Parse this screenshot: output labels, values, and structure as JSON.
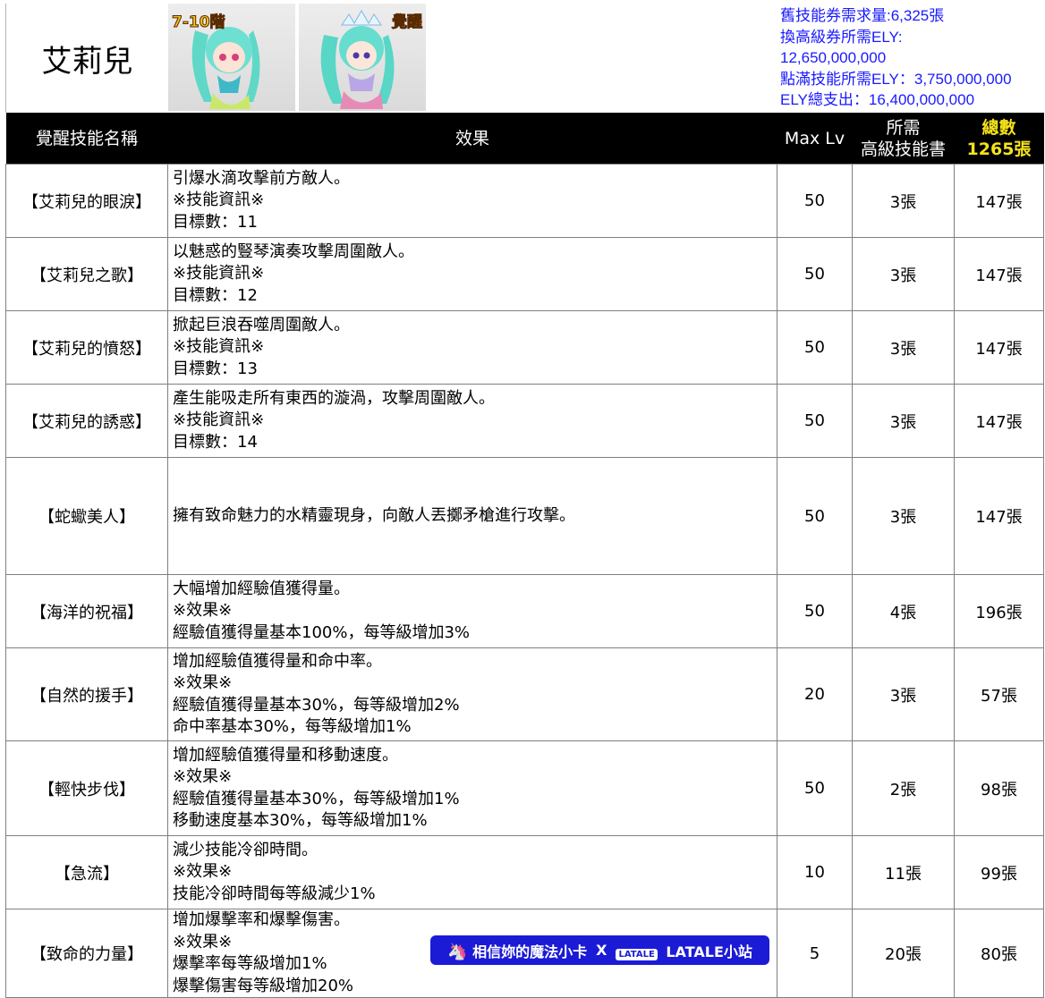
{
  "header": {
    "character_name": "艾莉兒",
    "portrait_tags": [
      "7-10階",
      "覺醒"
    ],
    "info_lines": [
      "舊技能券需求量:6,325張",
      "換高級券所需ELY:",
      "12,650,000,000",
      "點滿技能所需ELY：3,750,000,000",
      "ELY總支出：16,400,000,000"
    ]
  },
  "colors": {
    "info_text": "#1a1aff",
    "header_bg": "#000000",
    "total_highlight": "#f5e31b",
    "banner_bg": "#1b1bd6"
  },
  "table": {
    "headers": {
      "name": "覺醒技能名稱",
      "effect": "效果",
      "max_lv": "Max Lv",
      "books_line1": "所需",
      "books_line2": "高級技能書",
      "total_line1": "總數",
      "total_line2": "1265張"
    },
    "rows": [
      {
        "name": "【艾莉兒的眼淚】",
        "effect": [
          "引爆水滴攻擊前方敵人。",
          "※技能資訊※",
          "目標數：11"
        ],
        "max_lv": "50",
        "books": "3張",
        "total": "147張"
      },
      {
        "name": "【艾莉兒之歌】",
        "effect": [
          "以魅惑的豎琴演奏攻擊周圍敵人。",
          "※技能資訊※",
          "目標數：12"
        ],
        "max_lv": "50",
        "books": "3張",
        "total": "147張"
      },
      {
        "name": "【艾莉兒的憤怒】",
        "effect": [
          "掀起巨浪吞噬周圍敵人。",
          "※技能資訊※",
          "目標數：13"
        ],
        "max_lv": "50",
        "books": "3張",
        "total": "147張"
      },
      {
        "name": "【艾莉兒的誘惑】",
        "effect": [
          "產生能吸走所有東西的漩渦，攻擊周圍敵人。",
          "※技能資訊※",
          "目標數：14"
        ],
        "max_lv": "50",
        "books": "3張",
        "total": "147張"
      },
      {
        "name": "【蛇蠍美人】",
        "effect": [
          "擁有致命魅力的水精靈現身，向敵人丟擲矛槍進行攻擊。"
        ],
        "max_lv": "50",
        "books": "3張",
        "total": "147張"
      },
      {
        "name": "【海洋的祝福】",
        "effect": [
          "大幅增加經驗值獲得量。",
          "※效果※",
          "經驗值獲得量基本100%，每等級增加3%"
        ],
        "max_lv": "50",
        "books": "4張",
        "total": "196張"
      },
      {
        "name": "【自然的援手】",
        "effect": [
          "增加經驗值獲得量和命中率。",
          "※效果※",
          "經驗值獲得量基本30%，每等級增加2%",
          "命中率基本30%，每等級增加1%"
        ],
        "max_lv": "20",
        "books": "3張",
        "total": "57張"
      },
      {
        "name": "【輕快步伐】",
        "effect": [
          "增加經驗值獲得量和移動速度。",
          "※效果※",
          "經驗值獲得量基本30%，每等級增加1%",
          "移動速度基本30%，每等級增加1%"
        ],
        "max_lv": "50",
        "books": "2張",
        "total": "98張"
      },
      {
        "name": "【急流】",
        "effect": [
          "減少技能冷卻時間。",
          "※效果※",
          "技能冷卻時間每等級減少1%"
        ],
        "max_lv": "10",
        "books": "11張",
        "total": "99張"
      },
      {
        "name": "【致命的力量】",
        "effect": [
          "增加爆擊率和爆擊傷害。",
          "※效果※",
          "爆擊率每等級增加1%",
          "爆擊傷害每等級增加20%"
        ],
        "max_lv": "5",
        "books": "20張",
        "total": "80張"
      }
    ]
  },
  "banner": {
    "left_text": "相信妳的魔法小卡",
    "separator": "X",
    "badge_text": "LATALE",
    "right_text": "LATALE小站",
    "left_icon": "unicorn-icon"
  }
}
